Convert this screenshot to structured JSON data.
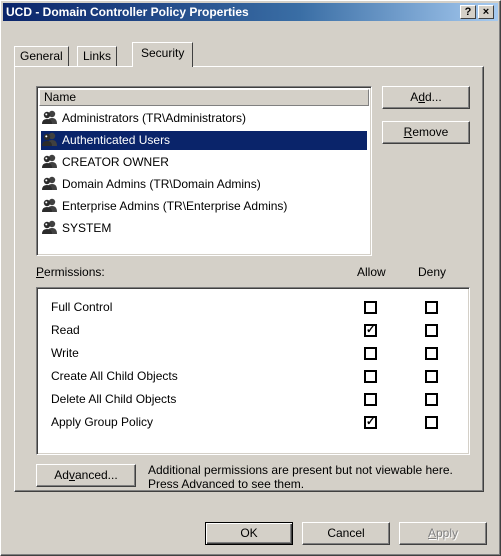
{
  "window": {
    "title": "UCD - Domain Controller Policy Properties",
    "help_glyph": "?",
    "close_glyph": "×"
  },
  "tabs": [
    {
      "label": "General"
    },
    {
      "label": "Links"
    },
    {
      "label": "Security"
    }
  ],
  "names_list": {
    "column_header": "Name",
    "items": [
      {
        "label": "Administrators (TR\\Administrators)",
        "icon": "group-icon",
        "selected": false
      },
      {
        "label": "Authenticated Users",
        "icon": "group-icon",
        "selected": true
      },
      {
        "label": "CREATOR OWNER",
        "icon": "group-icon",
        "selected": false
      },
      {
        "label": "Domain Admins (TR\\Domain Admins)",
        "icon": "group-icon",
        "selected": false
      },
      {
        "label": "Enterprise Admins (TR\\Enterprise Admins)",
        "icon": "group-icon",
        "selected": false
      },
      {
        "label": "SYSTEM",
        "icon": "group-icon",
        "selected": false
      }
    ]
  },
  "buttons": {
    "add_pre": "A",
    "add_key": "d",
    "add_post": "d...",
    "remove_key": "R",
    "remove_post": "emove",
    "advanced_pre": "Ad",
    "advanced_key": "v",
    "advanced_post": "anced...",
    "ok": "OK",
    "cancel": "Cancel",
    "apply_key": "A",
    "apply_post": "pply"
  },
  "permissions": {
    "label_key": "P",
    "label_post": "ermissions:",
    "allow_header": "Allow",
    "deny_header": "Deny",
    "checked_glyph": "✓",
    "rows": [
      {
        "label": "Full Control",
        "allow": false,
        "deny": false
      },
      {
        "label": "Read",
        "allow": true,
        "deny": false
      },
      {
        "label": "Write",
        "allow": false,
        "deny": false
      },
      {
        "label": "Create All Child Objects",
        "allow": false,
        "deny": false
      },
      {
        "label": "Delete All Child Objects",
        "allow": false,
        "deny": false
      },
      {
        "label": "Apply Group Policy",
        "allow": true,
        "deny": false
      }
    ]
  },
  "advanced_note": "Additional permissions are present but not viewable here. Press Advanced to see them.",
  "colors": {
    "selection": "#0a246a",
    "face": "#d4d0c8",
    "title_start": "#0a246a",
    "title_end": "#a6caf0"
  }
}
